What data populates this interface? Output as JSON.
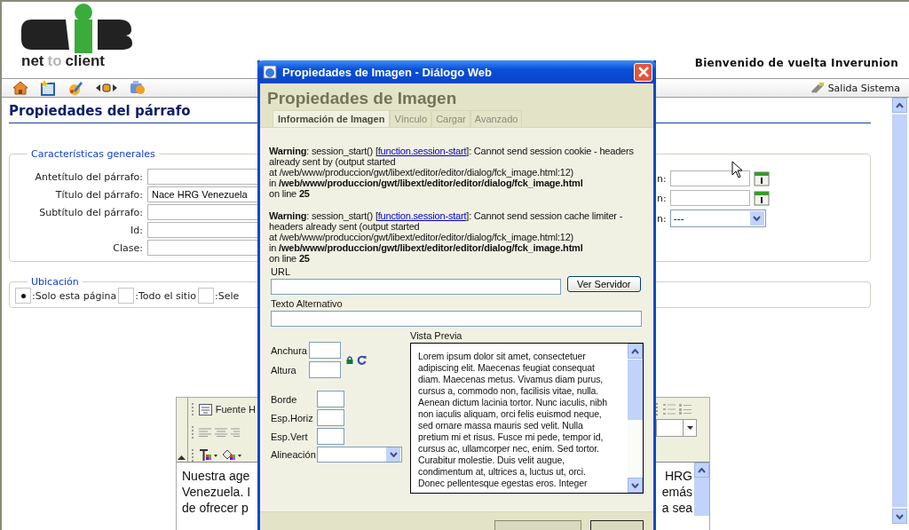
{
  "header": {
    "logo_words": [
      "net",
      "to",
      "client"
    ],
    "welcome": "Bienvenido de vuelta Inverunion"
  },
  "toolbar": {
    "exit": "Salida Sistema"
  },
  "page": {
    "title": "Propiedades del párrafo",
    "general": {
      "legend": "Características generales",
      "fields": [
        {
          "label": "Antetítulo del párrafo:"
        },
        {
          "label": "Título del párrafo:",
          "value": "Nace HRG Venezuela"
        },
        {
          "label": "Subtítulo del párrafo:"
        },
        {
          "label": "Id:"
        },
        {
          "label": "Clase:"
        }
      ],
      "right_fields": [
        {
          "label": "n:",
          "kind": "date"
        },
        {
          "label": "n:",
          "kind": "date"
        },
        {
          "label": "n:",
          "kind": "select",
          "value": "---"
        }
      ]
    },
    "location": {
      "legend": "Ubicación",
      "options": [
        {
          "label": ":Solo esta página",
          "selected": true
        },
        {
          "label": ":Todo el sitio",
          "selected": false
        },
        {
          "label": ":Sele",
          "selected": false
        }
      ]
    },
    "editor": {
      "font_label": "Fuente H",
      "left_lines": [
        "Nuestra age",
        "Venezuela. I",
        "de ofrecer p"
      ],
      "right_lines": [
        "HRG",
        "emás",
        "a sea"
      ]
    }
  },
  "dialog": {
    "title": "Propiedades de Imagen - Diálogo Web",
    "heading": "Propiedades de Imagen",
    "tabs": [
      {
        "label": "Información de Imagen",
        "selected": true
      },
      {
        "label": "Vínculo",
        "selected": false
      },
      {
        "label": "Cargar",
        "selected": false
      },
      {
        "label": "Avanzado",
        "selected": false
      }
    ],
    "warnings": [
      {
        "before": "**Warning**: session_start() [",
        "link": "function.session-start",
        "after": "]: Cannot send session cookie - headers already sent by (output started",
        "lines": [
          "at /web/www/produccion/gwt/libext/editor/editor/dialog/fck_image.html:12)",
          "in **/web/www/produccion/gwt/libext/editor/editor/dialog/fck_image.html**",
          "on line **25**"
        ]
      },
      {
        "before": "**Warning**: session_start() [",
        "link": "function.session-start",
        "after": "]: Cannot send session cache limiter - headers already sent (output started",
        "lines": [
          "at /web/www/produccion/gwt/libext/editor/editor/dialog/fck_image.html:12)",
          "in **/web/www/produccion/gwt/libext/editor/editor/dialog/fck_image.html**",
          "on line **25**"
        ]
      }
    ],
    "url_label": "URL",
    "browse_button": "Ver Servidor",
    "alt_label": "Texto Alternativo",
    "size_fields": [
      {
        "label": "Anchura"
      },
      {
        "label": "Altura"
      }
    ],
    "spacing_fields": [
      {
        "label": "Borde"
      },
      {
        "label": "Esp.Horiz"
      },
      {
        "label": "Esp.Vert"
      }
    ],
    "align_label": "Alineación",
    "preview_label": "Vista Previa",
    "preview_lines": [
      "Lorem ipsum dolor sit amet, consectetuer",
      "adipiscing elit. Maecenas feugiat consequat",
      "diam. Maecenas metus. Vivamus diam purus,",
      "cursus a, commodo non, facilisis vitae, nulla.",
      "Aenean dictum lacinia tortor. Nunc iaculis, nibh",
      "non iaculis aliquam, orci felis euismod neque,",
      "sed ornare massa mauris sed velit. Nulla",
      "pretium mi et risus. Fusce mi pede, tempor id,",
      "cursus ac, ullamcorper nec, enim. Sed tortor.",
      "Curabitur molestie. Duis velit augue,",
      "condimentum at, ultrices a, luctus ut, orci.",
      "Donec pellentesque egestas eros. Integer"
    ]
  }
}
